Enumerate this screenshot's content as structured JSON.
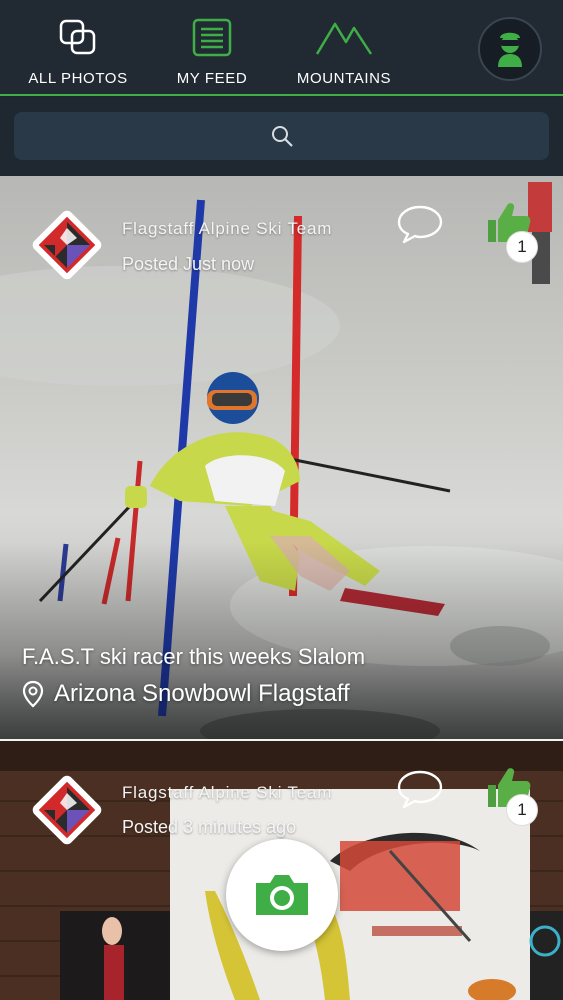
{
  "nav": {
    "items": [
      {
        "label": "ALL PHOTOS",
        "icon": "photos-icon"
      },
      {
        "label": "MY FEED",
        "icon": "feed-icon"
      },
      {
        "label": "MOUNTAINS",
        "icon": "mountains-icon"
      }
    ],
    "avatar_icon": "profile-avatar-icon"
  },
  "search": {
    "icon": "search-icon"
  },
  "posts": [
    {
      "poster": "Flagstaff Alpine Ski Team",
      "posted": "Posted Just now",
      "likes": "1",
      "caption": "F.A.S.T ski racer this weeks Slalom",
      "location": "Arizona Snowbowl Flagstaff"
    },
    {
      "poster": "Flagstaff Alpine Ski Team",
      "posted": "Posted 3 minutes ago",
      "likes": "1"
    }
  ],
  "fab": {
    "icon": "camera-icon"
  },
  "colors": {
    "accent": "#3fae46",
    "nav_bg": "#212a33",
    "search_bg": "#2a3947"
  }
}
